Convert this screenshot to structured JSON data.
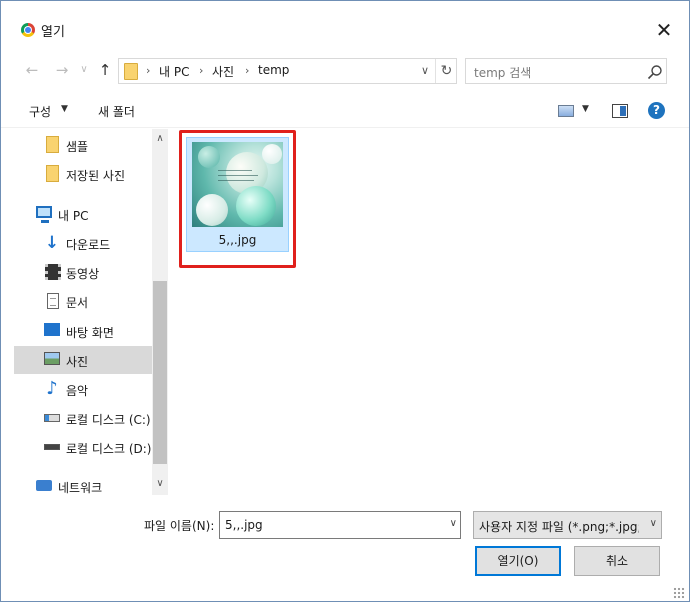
{
  "window": {
    "title": "열기",
    "app_icon": "chrome-icon",
    "close_glyph": "✕"
  },
  "nav": {
    "back_glyph": "←",
    "forward_glyph": "→",
    "history_glyph": "∨",
    "up_glyph": "↑",
    "breadcrumb_sep": "›",
    "breadcrumbs": [
      "내 PC",
      "사진",
      "temp"
    ],
    "address_dropdown_glyph": "∨",
    "refresh_glyph": "↻"
  },
  "search": {
    "placeholder": "temp 검색",
    "icon": "search-icon"
  },
  "toolbar": {
    "organize_label": "구성",
    "organize_arrow": "▼",
    "new_folder_label": "새 폴더",
    "view_arrow": "▼",
    "help_glyph": "?"
  },
  "sidebar": {
    "items": [
      {
        "label": "샘플",
        "icon": "folder-icon"
      },
      {
        "label": "저장된 사진",
        "icon": "folder-icon"
      },
      {
        "label": "내 PC",
        "icon": "computer-icon"
      },
      {
        "label": "다운로드",
        "icon": "download-icon"
      },
      {
        "label": "동영상",
        "icon": "video-icon"
      },
      {
        "label": "문서",
        "icon": "document-icon"
      },
      {
        "label": "바탕 화면",
        "icon": "desktop-icon"
      },
      {
        "label": "사진",
        "icon": "pictures-icon",
        "selected": true
      },
      {
        "label": "음악",
        "icon": "music-icon"
      },
      {
        "label": "로컬 디스크 (C:)",
        "icon": "drive-icon"
      },
      {
        "label": "로컬 디스크 (D:)",
        "icon": "drive-icon"
      },
      {
        "label": "네트워크",
        "icon": "network-icon"
      }
    ],
    "scroll_up_glyph": "∧",
    "scroll_down_glyph": "∨"
  },
  "files": [
    {
      "name": "5,,.jpg",
      "selected": true
    }
  ],
  "bottom": {
    "filename_label": "파일 이름(N):",
    "filename_value": "5,,.jpg",
    "filename_dropdown_glyph": "∨",
    "filetype_value": "사용자 지정 파일 (*.png;*.jpg;*",
    "filetype_dropdown_glyph": "∨",
    "open_button": "열기(O)",
    "cancel_button": "취소"
  },
  "colors": {
    "selection_bg": "#cce8ff",
    "highlight_border": "#e0201c",
    "accent": "#0078d7"
  }
}
